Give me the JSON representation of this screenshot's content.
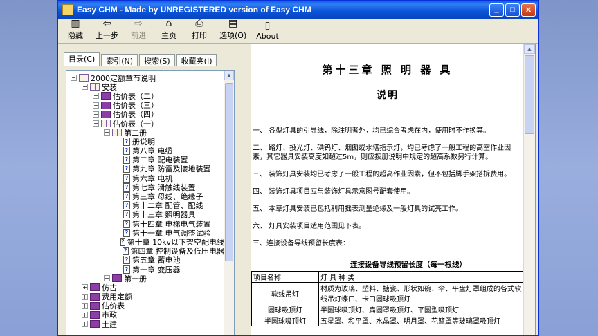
{
  "window": {
    "title": "Easy CHM - Made by UNREGISTERED version of Easy CHM"
  },
  "toolbar": {
    "hide": "隐藏",
    "back": "上一步",
    "forward": "前进",
    "home": "主页",
    "print": "打印",
    "options": "选项(O)",
    "about": "About"
  },
  "tabs": [
    "目录(C)",
    "索引(N)",
    "搜索(S)",
    "收藏夹(I)"
  ],
  "tree": [
    {
      "level": 0,
      "exp": "−",
      "icon": "book-open",
      "label": "2000定额章节说明"
    },
    {
      "level": 1,
      "exp": "−",
      "icon": "book-open",
      "label": "安装"
    },
    {
      "level": 2,
      "exp": "+",
      "icon": "book",
      "label": "估价表（二）"
    },
    {
      "level": 2,
      "exp": "+",
      "icon": "book",
      "label": "估价表（三）"
    },
    {
      "level": 2,
      "exp": "+",
      "icon": "book",
      "label": "估价表（四）"
    },
    {
      "level": 2,
      "exp": "−",
      "icon": "book-open",
      "label": "估价表（一）"
    },
    {
      "level": 3,
      "exp": "−",
      "icon": "book-open",
      "label": "第二册"
    },
    {
      "level": 4,
      "exp": "",
      "icon": "page",
      "label": "册说明"
    },
    {
      "level": 4,
      "exp": "",
      "icon": "page",
      "label": "第八章 电缆"
    },
    {
      "level": 4,
      "exp": "",
      "icon": "page",
      "label": "第二章 配电装置"
    },
    {
      "level": 4,
      "exp": "",
      "icon": "page",
      "label": "第九章 防雷及接地装置"
    },
    {
      "level": 4,
      "exp": "",
      "icon": "page",
      "label": "第六章 电机"
    },
    {
      "level": 4,
      "exp": "",
      "icon": "page",
      "label": "第七章 滑触线装置"
    },
    {
      "level": 4,
      "exp": "",
      "icon": "page",
      "label": "第三章 母线、绝缘子"
    },
    {
      "level": 4,
      "exp": "",
      "icon": "page",
      "label": "第十二章 配管、配线"
    },
    {
      "level": 4,
      "exp": "",
      "icon": "page",
      "label": "第十三章 照明器具"
    },
    {
      "level": 4,
      "exp": "",
      "icon": "page",
      "label": "第十四章 电梯电气装置"
    },
    {
      "level": 4,
      "exp": "",
      "icon": "page",
      "label": "第十一章 电气调整试验"
    },
    {
      "level": 4,
      "exp": "",
      "icon": "page",
      "label": "第十章 10kv以下架空配电线"
    },
    {
      "level": 4,
      "exp": "",
      "icon": "page",
      "label": "第四章 控制设备及低压电器"
    },
    {
      "level": 4,
      "exp": "",
      "icon": "page",
      "label": "第五章 蓄电池"
    },
    {
      "level": 4,
      "exp": "",
      "icon": "page",
      "label": "第一章 变压器"
    },
    {
      "level": 3,
      "exp": "+",
      "icon": "book",
      "label": "第一册"
    },
    {
      "level": 1,
      "exp": "+",
      "icon": "book",
      "label": "仿古"
    },
    {
      "level": 1,
      "exp": "+",
      "icon": "book",
      "label": "费用定额"
    },
    {
      "level": 1,
      "exp": "+",
      "icon": "book",
      "label": "估价表"
    },
    {
      "level": 1,
      "exp": "+",
      "icon": "book",
      "label": "市政"
    },
    {
      "level": 1,
      "exp": "+",
      "icon": "book",
      "label": "土建"
    }
  ],
  "doc": {
    "title": "第十三章 照 明 器 具",
    "subtitle": "说明",
    "paragraphs": [
      "一、 各型灯具的引导线，除注明者外，均已综合考虑在内，使用时不作换算。",
      "二、 路灯、投光灯、碘钨灯、烟囱或水塔指示灯，均已考虑了一般工程的高空作业因素，其它器具安装高度如超过5m，则应按册说明中规定的超高系数另行计算。",
      "三、 装饰灯具安装均已考虑了一般工程的超高作业因素，但不包括脚手架搭拆费用。",
      "四、 装饰灯具项目应与装饰灯具示意图号配套使用。",
      "五、 本章灯具安装已包括利用摇表测量绝缘及一般灯具的试亮工作。",
      "六、 灯具安装项目适用范围见下表。",
      "三、连接设备导线预留长度表："
    ],
    "table_caption": "连接设备导线预留长度（每一根线）",
    "table_headers": [
      "项目名称",
      "灯 具 种 类"
    ],
    "table_rows": [
      [
        "软线吊灯",
        "材质为玻璃、塑料、搪瓷、形状如碗、伞、平盘灯罩组成的各式软线吊灯蝶口、卡口圆球吸顶灯"
      ],
      [
        "圆球吸顶灯",
        "半圆球吸顶灯、扁圆罩吸顶灯、平圆型吸顶灯"
      ],
      [
        "半圆球吸顶灯",
        "五星罩、和平罩、水晶罩、明月罩、花篮罩等玻璃罩吸顶灯"
      ]
    ]
  }
}
